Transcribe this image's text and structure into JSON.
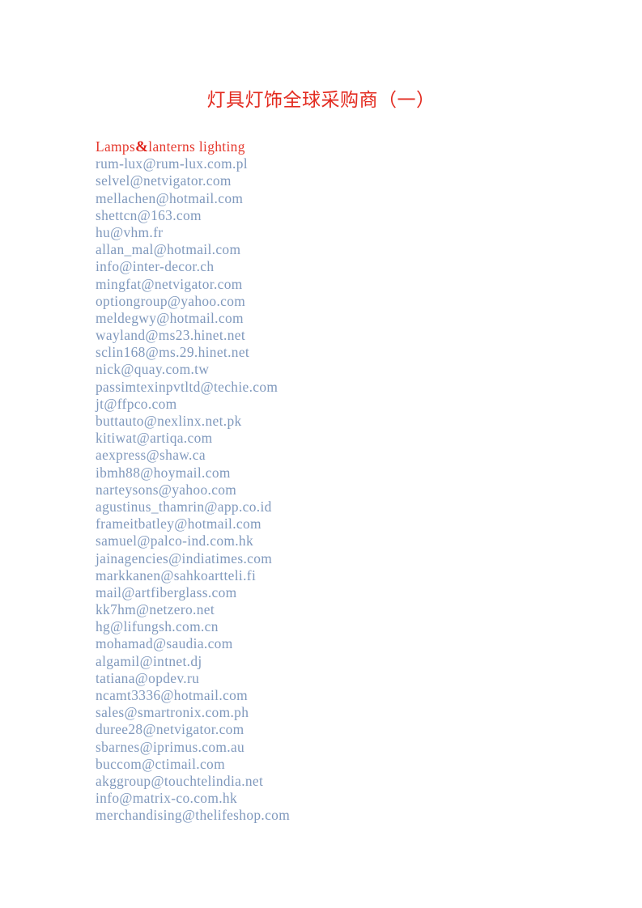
{
  "document": {
    "title": "灯具灯饰全球采购商（一）",
    "title_color": "#e32b20",
    "body_color": "#8099bd",
    "heading_color": "#e5392e",
    "background_color": "#ffffff"
  },
  "section": {
    "heading_prefix": "Lamps",
    "heading_ampersand": "&",
    "heading_suffix": "lanterns lighting",
    "heading_full": "Lamps&lanterns lighting"
  },
  "emails": [
    "rum-lux@rum-lux.com.pl",
    "selvel@netvigator.com",
    "mellachen@hotmail.com",
    "shettcn@163.com",
    "hu@vhm.fr",
    "allan_mal@hotmail.com",
    "info@inter-decor.ch",
    "mingfat@netvigator.com",
    "optiongroup@yahoo.com",
    "meldegwy@hotmail.com",
    "wayland@ms23.hinet.net",
    "sclin168@ms.29.hinet.net",
    "nick@quay.com.tw",
    "passimtexinpvtltd@techie.com",
    "jt@ffpco.com",
    "buttauto@nexlinx.net.pk",
    "kitiwat@artiqa.com",
    "aexpress@shaw.ca",
    "ibmh88@hoymail.com",
    "narteysons@yahoo.com",
    "agustinus_thamrin@app.co.id",
    "frameitbatley@hotmail.com",
    "samuel@palco-ind.com.hk",
    "jainagencies@indiatimes.com",
    "markkanen@sahkoartteli.fi",
    "mail@artfiberglass.com",
    "kk7hm@netzero.net",
    "hg@lifungsh.com.cn",
    "mohamad@saudia.com",
    "algamil@intnet.dj",
    "tatiana@opdev.ru",
    "ncamt3336@hotmail.com",
    "sales@smartronix.com.ph",
    "duree28@netvigator.com",
    "sbarnes@iprimus.com.au",
    "buccom@ctimail.com",
    "akggroup@touchtelindia.net",
    "info@matrix-co.com.hk",
    "merchandising@thelifeshop.com"
  ]
}
